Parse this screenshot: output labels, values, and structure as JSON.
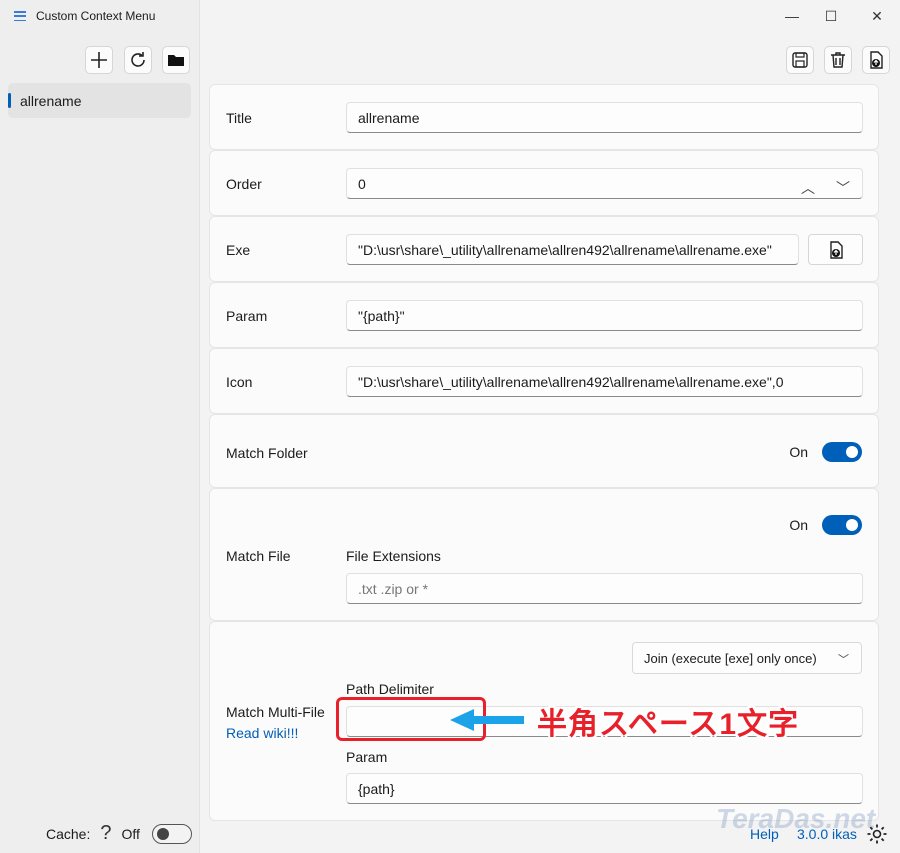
{
  "app": {
    "title": "Custom Context Menu"
  },
  "sidebar": {
    "toolbar": {
      "add_icon": "plus-icon",
      "refresh_icon": "refresh-icon",
      "folder_icon": "folder-icon"
    },
    "items": [
      {
        "label": "allrename",
        "selected": true
      }
    ],
    "cache": {
      "label": "Cache:",
      "help": "?",
      "state": "Off"
    }
  },
  "window_controls": {
    "minimize": "—",
    "maximize": "☐",
    "close": "✕"
  },
  "form": {
    "title": {
      "label": "Title",
      "value": "allrename"
    },
    "order": {
      "label": "Order",
      "value": "0"
    },
    "exe": {
      "label": "Exe",
      "value": "\"D:\\usr\\share\\_utility\\allrename\\allren492\\allrename\\allrename.exe\""
    },
    "param": {
      "label": "Param",
      "value": "\"{path}\""
    },
    "icon": {
      "label": "Icon",
      "value": "\"D:\\usr\\share\\_utility\\allrename\\allren492\\allrename\\allrename.exe\",0"
    },
    "match_folder": {
      "label": "Match Folder",
      "state": "On"
    },
    "match_file": {
      "label": "Match File",
      "state": "On",
      "extensions_label": "File Extensions",
      "extensions_placeholder": ".txt .zip  or *"
    },
    "match_multi": {
      "label": "Match Multi-File",
      "link": "Read wiki!!!",
      "mode": "Join (execute [exe] only once)",
      "delimiter_label": "Path Delimiter",
      "delimiter_value": "",
      "param_label": "Param",
      "param_value": "{path}"
    }
  },
  "annotation": {
    "text": "半角スペース1文字",
    "color": "#e8202a"
  },
  "watermark": "TeraDas.net",
  "statusbar": {
    "help": "Help",
    "version": "3.0.0 ikas"
  },
  "colors": {
    "accent": "#005fb8"
  }
}
